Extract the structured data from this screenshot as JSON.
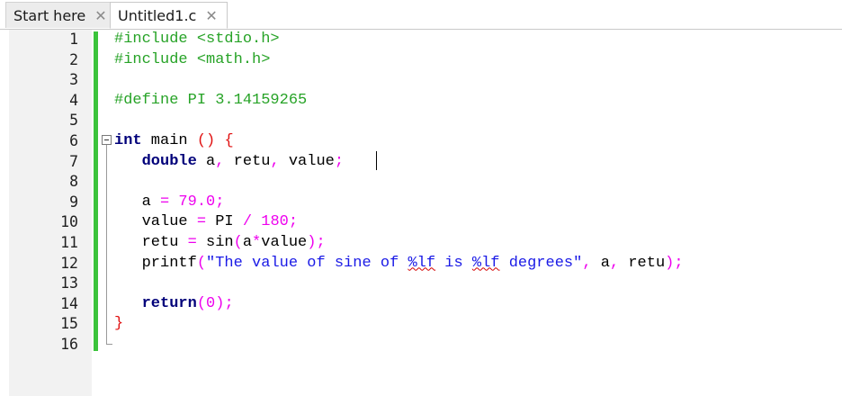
{
  "tabs": [
    {
      "label": "Start here",
      "close": "✕"
    },
    {
      "label": "Untitled1.c",
      "close": "✕"
    }
  ],
  "editor": {
    "line_numbers": [
      "1",
      "2",
      "3",
      "4",
      "5",
      "6",
      "7",
      "8",
      "9",
      "10",
      "11",
      "12",
      "13",
      "14",
      "15",
      "16"
    ],
    "code": {
      "l1": "#include <stdio.h>",
      "l2": "#include <math.h>",
      "l4": "#define PI 3.14159265",
      "l6_kw": "int",
      "l6_rest": " main ",
      "l6_paren": "()",
      "l6_sp": " ",
      "l6_brace": "{",
      "l7_indent": "   ",
      "l7_kw": "double",
      "l7_a": " a",
      "l7_c1": ",",
      "l7_retu": " retu",
      "l7_c2": ",",
      "l7_value": " value",
      "l7_semi": ";",
      "l9_lhs": "   a ",
      "l9_eq": "=",
      "l9_sp": " ",
      "l9_num": "79.0",
      "l9_semi": ";",
      "l10_lhs": "   value ",
      "l10_eq": "=",
      "l10_mid": " PI ",
      "l10_div": "/",
      "l10_sp": " ",
      "l10_num": "180",
      "l10_semi": ";",
      "l11_lhs": "   retu ",
      "l11_eq": "=",
      "l11_fn": " sin",
      "l11_po": "(",
      "l11_a": "a",
      "l11_mul": "*",
      "l11_v": "value",
      "l11_pc": ")",
      "l11_semi": ";",
      "l12_fn": "   printf",
      "l12_po": "(",
      "l12_str1": "\"The value of sine of ",
      "l12_fmt1": "%lf",
      "l12_str2": " is ",
      "l12_fmt2": "%lf",
      "l12_str3": " degrees\"",
      "l12_c1": ",",
      "l12_a": " a",
      "l12_c2": ",",
      "l12_retu": " retu",
      "l12_pc": ")",
      "l12_semi": ";",
      "l14_indent": "   ",
      "l14_kw": "return",
      "l14_po": "(",
      "l14_num": "0",
      "l14_pc": ")",
      "l14_semi": ";",
      "l15_brace": "}"
    }
  },
  "colors": {
    "preprocessor": "#27a327",
    "keyword": "#00007a",
    "number": "#ee00ee",
    "string": "#1a1ae6",
    "brace": "#e01010",
    "change_bar": "#3bc43b"
  }
}
